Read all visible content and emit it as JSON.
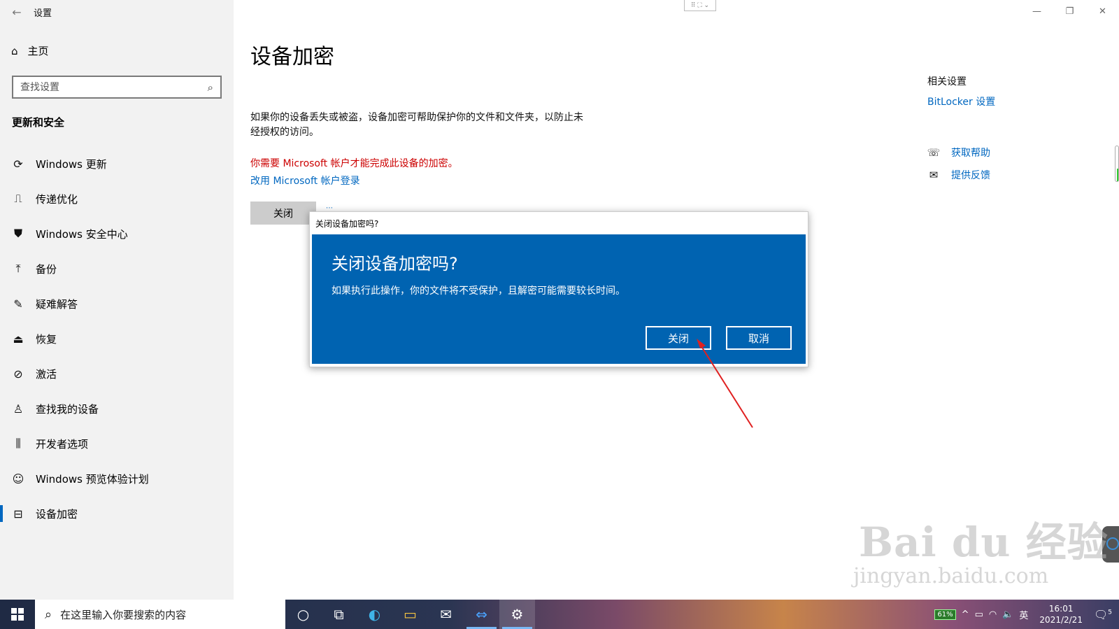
{
  "window": {
    "title": "设置",
    "controls": {
      "minimize": "—",
      "maximize": "❐",
      "close": "✕"
    },
    "top_indicator": "⠿ ⛶ ⌄"
  },
  "sidebar": {
    "back": "←",
    "home": {
      "icon": "⌂",
      "label": "主页"
    },
    "search": {
      "placeholder": "查找设置",
      "icon": "⌕"
    },
    "section_title": "更新和安全",
    "items": [
      {
        "icon": "⟳",
        "label": "Windows 更新"
      },
      {
        "icon": "⎍",
        "label": "传递优化"
      },
      {
        "icon": "⛊",
        "label": "Windows 安全中心"
      },
      {
        "icon": "⤒",
        "label": "备份"
      },
      {
        "icon": "✎",
        "label": "疑难解答"
      },
      {
        "icon": "⏏",
        "label": "恢复"
      },
      {
        "icon": "⊘",
        "label": "激活"
      },
      {
        "icon": "♙",
        "label": "查找我的设备"
      },
      {
        "icon": "⫼",
        "label": "开发者选项"
      },
      {
        "icon": "☺",
        "label": "Windows 预览体验计划"
      },
      {
        "icon": "⊟",
        "label": "设备加密"
      }
    ]
  },
  "main": {
    "title": "设备加密",
    "description": "如果你的设备丢失或被盗，设备加密可帮助保护你的文件和文件夹，以防止未经授权的访问。",
    "warning": "你需要 Microsoft 帐户才能完成此设备的加密。",
    "ms_link": "改用 Microsoft 帐户登录",
    "off_button": "关闭",
    "spinner": "⋯",
    "related": {
      "title": "相关设置",
      "bitlocker": "BitLocker 设置"
    },
    "help": [
      {
        "icon": "☏",
        "label": "获取帮助"
      },
      {
        "icon": "✉",
        "label": "提供反馈"
      }
    ]
  },
  "dialog": {
    "titlebar": "关闭设备加密吗?",
    "heading": "关闭设备加密吗?",
    "text": "如果执行此操作，你的文件将不受保护，且解密可能需要较长时间。",
    "confirm": "关闭",
    "cancel": "取消",
    "colors": {
      "background": "#0063b1",
      "arrow": "#e02020"
    }
  },
  "watermark": {
    "logo": "Bai du 经验",
    "url": "jingyan.baidu.com"
  },
  "taskbar": {
    "search_placeholder": "在这里输入你要搜索的内容",
    "search_icon": "⌕",
    "apps": [
      {
        "name": "cortana",
        "glyph": "○"
      },
      {
        "name": "task-view",
        "glyph": "⧉"
      },
      {
        "name": "edge",
        "glyph": "◐"
      },
      {
        "name": "file-explorer",
        "glyph": "▭"
      },
      {
        "name": "mail",
        "glyph": "✉"
      },
      {
        "name": "teamviewer",
        "glyph": "⇔"
      },
      {
        "name": "settings",
        "glyph": "⚙"
      }
    ],
    "tray": {
      "battery": "61%",
      "chevron": "^",
      "battery_icon": "▭",
      "wifi": "◠",
      "volume": "🔈",
      "ime": "英",
      "time": "16:01",
      "date": "2021/2/21",
      "notifications": "🗨",
      "notification_count": "5"
    }
  }
}
